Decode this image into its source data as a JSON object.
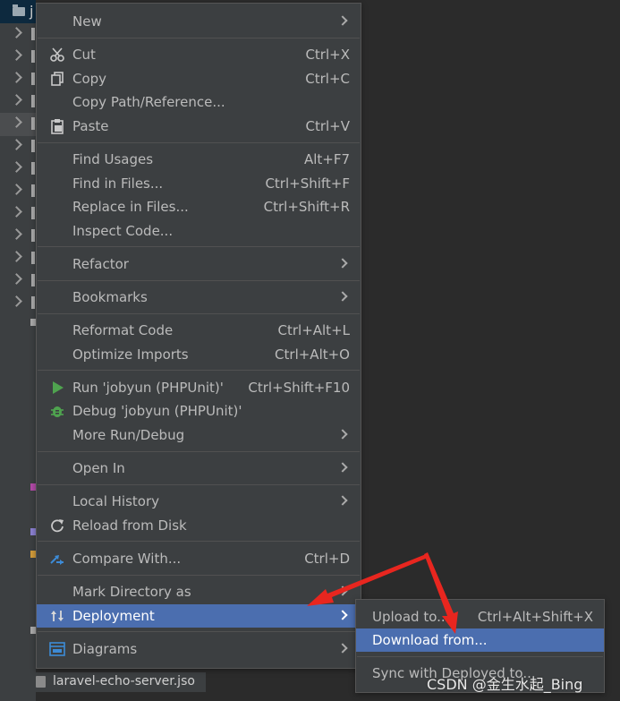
{
  "project_tree": {
    "root_letter": "j",
    "visible_file": "laravel-echo-server.jso"
  },
  "context_menu": {
    "groups": [
      [
        {
          "label": "New",
          "shortcut": "",
          "submenu": true,
          "icon": ""
        }
      ],
      [
        {
          "label": "Cut",
          "shortcut": "Ctrl+X",
          "submenu": false,
          "icon": "scissors-icon"
        },
        {
          "label": "Copy",
          "shortcut": "Ctrl+C",
          "submenu": false,
          "icon": "copy-icon"
        },
        {
          "label": "Copy Path/Reference...",
          "shortcut": "",
          "submenu": false,
          "icon": ""
        },
        {
          "label": "Paste",
          "shortcut": "Ctrl+V",
          "submenu": false,
          "icon": "clipboard-icon"
        }
      ],
      [
        {
          "label": "Find Usages",
          "shortcut": "Alt+F7",
          "submenu": false,
          "icon": ""
        },
        {
          "label": "Find in Files...",
          "shortcut": "Ctrl+Shift+F",
          "submenu": false,
          "icon": ""
        },
        {
          "label": "Replace in Files...",
          "shortcut": "Ctrl+Shift+R",
          "submenu": false,
          "icon": ""
        },
        {
          "label": "Inspect Code...",
          "shortcut": "",
          "submenu": false,
          "icon": ""
        }
      ],
      [
        {
          "label": "Refactor",
          "shortcut": "",
          "submenu": true,
          "icon": ""
        }
      ],
      [
        {
          "label": "Bookmarks",
          "shortcut": "",
          "submenu": true,
          "icon": ""
        }
      ],
      [
        {
          "label": "Reformat Code",
          "shortcut": "Ctrl+Alt+L",
          "submenu": false,
          "icon": ""
        },
        {
          "label": "Optimize Imports",
          "shortcut": "Ctrl+Alt+O",
          "submenu": false,
          "icon": ""
        }
      ],
      [
        {
          "label": "Run 'jobyun (PHPUnit)'",
          "shortcut": "Ctrl+Shift+F10",
          "submenu": false,
          "icon": "run-icon"
        },
        {
          "label": "Debug 'jobyun (PHPUnit)'",
          "shortcut": "",
          "submenu": false,
          "icon": "debug-icon"
        },
        {
          "label": "More Run/Debug",
          "shortcut": "",
          "submenu": true,
          "icon": ""
        }
      ],
      [
        {
          "label": "Open In",
          "shortcut": "",
          "submenu": true,
          "icon": ""
        }
      ],
      [
        {
          "label": "Local History",
          "shortcut": "",
          "submenu": true,
          "icon": ""
        },
        {
          "label": "Reload from Disk",
          "shortcut": "",
          "submenu": false,
          "icon": "reload-icon"
        }
      ],
      [
        {
          "label": "Compare With...",
          "shortcut": "Ctrl+D",
          "submenu": false,
          "icon": "compare-icon"
        }
      ],
      [
        {
          "label": "Mark Directory as",
          "shortcut": "",
          "submenu": true,
          "icon": ""
        },
        {
          "label": "Deployment",
          "shortcut": "",
          "submenu": true,
          "icon": "deployment-icon",
          "highlighted": true
        }
      ],
      [
        {
          "label": "Diagrams",
          "shortcut": "",
          "submenu": true,
          "icon": "diagrams-icon"
        }
      ]
    ]
  },
  "deployment_submenu": {
    "items": [
      {
        "label": "Upload to...",
        "shortcut": "Ctrl+Alt+Shift+X"
      },
      {
        "label": "Download from...",
        "shortcut": "",
        "highlighted": true
      },
      {
        "label": "Sync with Deployed to...",
        "shortcut": ""
      }
    ]
  },
  "watermark": "CSDN @金生水起_Bing",
  "colors": {
    "menu_bg": "#3c3f41",
    "highlight": "#4b6eaf",
    "text": "#bbbbbb",
    "annotation_arrow": "#e8261f"
  }
}
